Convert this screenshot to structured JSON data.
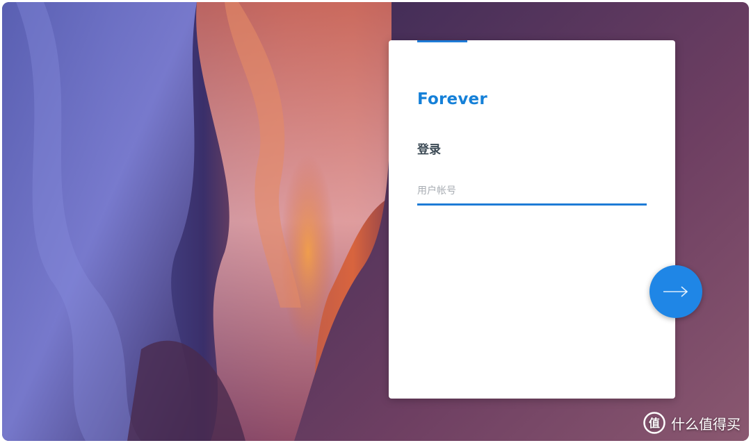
{
  "login": {
    "brand": "Forever",
    "title": "登录",
    "account_placeholder": "用户帐号",
    "account_value": ""
  },
  "next_button": {
    "icon": "arrow-right-icon"
  },
  "watermark": {
    "logo_glyph": "值",
    "text": "什么值得买"
  },
  "colors": {
    "accent": "#1e7bd6",
    "button": "#1f86e6",
    "brand_text": "#1580d8",
    "title_text": "#3c4a55"
  }
}
